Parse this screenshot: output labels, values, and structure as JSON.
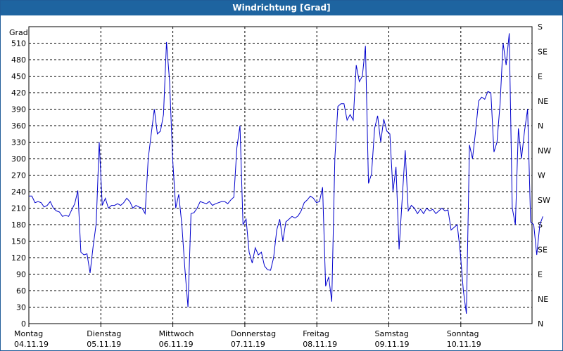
{
  "window": {
    "title": "Windrichtung [Grad]"
  },
  "colors": {
    "title_bg": "#1e64a0",
    "line": "#0000cc",
    "grid": "#000000"
  },
  "chart_data": {
    "type": "line",
    "title": "Windrichtung [Grad]",
    "ylabel": "Grad",
    "ylim": [
      0,
      540
    ],
    "y_ticks": [
      0,
      30,
      60,
      90,
      120,
      150,
      180,
      210,
      240,
      270,
      300,
      330,
      360,
      390,
      420,
      450,
      480,
      510
    ],
    "y2_ticks": [
      "N",
      "NE",
      "E",
      "SE",
      "S",
      "SW",
      "W",
      "NW",
      "N",
      "NE",
      "E",
      "SE",
      "S"
    ],
    "x_ticks": [
      {
        "day": "Montag",
        "date": "04.11.19"
      },
      {
        "day": "Dienstag",
        "date": "05.11.19"
      },
      {
        "day": "Mittwoch",
        "date": "06.11.19"
      },
      {
        "day": "Donnerstag",
        "date": "07.11.19"
      },
      {
        "day": "Freitag",
        "date": "08.11.19"
      },
      {
        "day": "Samstag",
        "date": "09.11.19"
      },
      {
        "day": "Sonntag",
        "date": "10.11.19"
      }
    ],
    "xlim": [
      0,
      7
    ],
    "grid": true,
    "series": [
      {
        "values": [
          [
            0.0,
            232
          ],
          [
            0.05,
            232
          ],
          [
            0.1,
            220
          ],
          [
            0.15,
            222
          ],
          [
            0.2,
            220
          ],
          [
            0.25,
            212
          ],
          [
            0.3,
            215
          ],
          [
            0.35,
            222
          ],
          [
            0.4,
            210
          ],
          [
            0.45,
            205
          ],
          [
            0.5,
            203
          ],
          [
            0.55,
            195
          ],
          [
            0.6,
            197
          ],
          [
            0.65,
            195
          ],
          [
            0.7,
            207
          ],
          [
            0.75,
            218
          ],
          [
            0.8,
            242
          ],
          [
            0.85,
            130
          ],
          [
            0.9,
            125
          ],
          [
            0.95,
            127
          ],
          [
            1.0,
            92
          ],
          [
            1.05,
            140
          ],
          [
            1.1,
            182
          ],
          [
            1.15,
            330
          ],
          [
            1.2,
            215
          ],
          [
            1.25,
            228
          ],
          [
            1.3,
            210
          ],
          [
            1.35,
            215
          ],
          [
            1.4,
            215
          ],
          [
            1.45,
            218
          ],
          [
            1.5,
            215
          ],
          [
            1.55,
            220
          ],
          [
            1.6,
            228
          ],
          [
            1.65,
            222
          ],
          [
            1.7,
            210
          ],
          [
            1.75,
            215
          ],
          [
            1.8,
            212
          ],
          [
            1.85,
            210
          ],
          [
            1.9,
            200
          ],
          [
            1.95,
            300
          ],
          [
            2.0,
            345
          ],
          [
            2.05,
            390
          ],
          [
            2.1,
            345
          ],
          [
            2.15,
            350
          ],
          [
            2.2,
            380
          ],
          [
            2.25,
            512
          ],
          [
            2.3,
            440
          ],
          [
            2.35,
            300
          ],
          [
            2.4,
            210
          ],
          [
            2.45,
            235
          ],
          [
            2.5,
            180
          ],
          [
            2.55,
            100
          ],
          [
            2.6,
            30
          ],
          [
            2.65,
            200
          ],
          [
            2.7,
            202
          ],
          [
            2.75,
            210
          ],
          [
            2.8,
            222
          ],
          [
            2.85,
            220
          ],
          [
            2.9,
            218
          ],
          [
            2.95,
            222
          ],
          [
            3.0,
            215
          ],
          [
            3.05,
            218
          ],
          [
            3.1,
            220
          ],
          [
            3.15,
            222
          ],
          [
            3.2,
            222
          ],
          [
            3.25,
            218
          ],
          [
            3.3,
            225
          ],
          [
            3.35,
            230
          ],
          [
            3.4,
            320
          ],
          [
            3.45,
            360
          ],
          [
            3.5,
            180
          ],
          [
            3.55,
            190
          ],
          [
            3.6,
            130
          ],
          [
            3.65,
            110
          ],
          [
            3.7,
            138
          ],
          [
            3.75,
            125
          ],
          [
            3.8,
            130
          ],
          [
            3.85,
            105
          ],
          [
            3.9,
            98
          ],
          [
            3.95,
            97
          ],
          [
            4.0,
            120
          ],
          [
            4.05,
            170
          ],
          [
            4.1,
            190
          ],
          [
            4.15,
            150
          ],
          [
            4.2,
            185
          ],
          [
            4.25,
            190
          ],
          [
            4.3,
            195
          ],
          [
            4.35,
            192
          ],
          [
            4.4,
            196
          ],
          [
            4.45,
            205
          ],
          [
            4.5,
            220
          ],
          [
            4.55,
            225
          ],
          [
            4.6,
            232
          ],
          [
            4.65,
            228
          ],
          [
            4.7,
            220
          ],
          [
            4.75,
            222
          ],
          [
            4.8,
            248
          ],
          [
            4.85,
            68
          ],
          [
            4.9,
            85
          ],
          [
            4.95,
            40
          ],
          [
            5.0,
            300
          ],
          [
            5.05,
            395
          ],
          [
            5.1,
            400
          ],
          [
            5.15,
            400
          ],
          [
            5.2,
            370
          ],
          [
            5.25,
            380
          ],
          [
            5.3,
            370
          ],
          [
            5.35,
            470
          ],
          [
            5.4,
            440
          ],
          [
            5.45,
            450
          ],
          [
            5.5,
            505
          ],
          [
            5.55,
            255
          ],
          [
            5.6,
            272
          ],
          [
            5.65,
            355
          ],
          [
            5.7,
            378
          ],
          [
            5.75,
            330
          ],
          [
            5.8,
            372
          ],
          [
            5.85,
            350
          ],
          [
            5.9,
            345
          ],
          [
            5.95,
            240
          ],
          [
            6.0,
            285
          ],
          [
            6.05,
            135
          ],
          [
            6.1,
            225
          ],
          [
            6.15,
            315
          ],
          [
            6.2,
            205
          ],
          [
            6.25,
            215
          ],
          [
            6.3,
            210
          ],
          [
            6.35,
            200
          ],
          [
            6.4,
            208
          ],
          [
            6.45,
            200
          ],
          [
            6.5,
            210
          ],
          [
            6.55,
            205
          ],
          [
            6.6,
            208
          ],
          [
            6.65,
            200
          ],
          [
            6.7,
            205
          ],
          [
            6.75,
            210
          ],
          [
            6.8,
            205
          ],
          [
            6.85,
            207
          ],
          [
            6.9,
            170
          ],
          [
            6.95,
            175
          ],
          [
            7.0,
            180
          ],
          [
            7.05,
            130
          ],
          [
            7.1,
            60
          ],
          [
            7.15,
            18
          ],
          [
            7.2,
            325
          ],
          [
            7.25,
            300
          ],
          [
            7.3,
            350
          ],
          [
            7.35,
            405
          ],
          [
            7.4,
            412
          ],
          [
            7.45,
            408
          ],
          [
            7.5,
            422
          ],
          [
            7.55,
            420
          ],
          [
            7.6,
            312
          ],
          [
            7.65,
            330
          ],
          [
            7.7,
            400
          ],
          [
            7.75,
            510
          ],
          [
            7.8,
            470
          ],
          [
            7.85,
            528
          ],
          [
            7.9,
            210
          ],
          [
            7.95,
            180
          ],
          [
            8.0,
            355
          ],
          [
            8.05,
            300
          ],
          [
            8.1,
            350
          ],
          [
            8.15,
            390
          ],
          [
            8.2,
            185
          ],
          [
            8.25,
            180
          ],
          [
            8.3,
            125
          ],
          [
            8.35,
            180
          ],
          [
            8.4,
            195
          ]
        ]
      }
    ]
  }
}
